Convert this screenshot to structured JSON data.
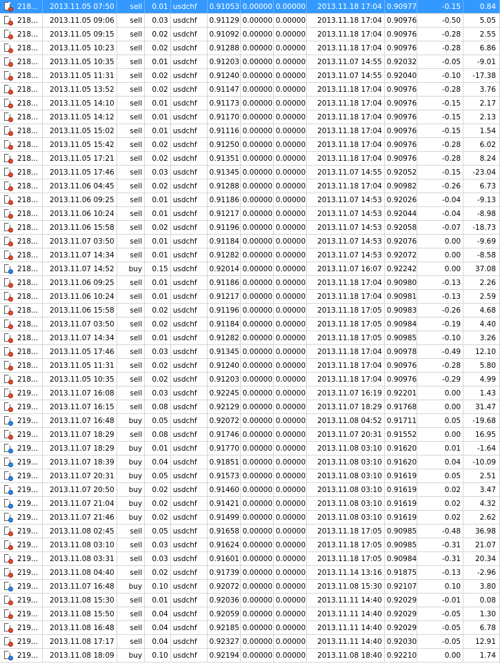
{
  "rows": [
    {
      "ticket": "218...",
      "open_time": "2013.11.05 07:50",
      "type": "sell",
      "size": "0.01",
      "symbol": "usdchf",
      "price": "0.91053",
      "sl": "0.00000",
      "tp": "0.00000",
      "close_time": "2013.11.18 17:04",
      "close_price": "0.90977",
      "commission": "-0.15",
      "profit": "0.84",
      "icon": "sell-order-icon",
      "selected": true
    },
    {
      "ticket": "218...",
      "open_time": "2013.11.05 09:06",
      "type": "sell",
      "size": "0.03",
      "symbol": "usdchf",
      "price": "0.91129",
      "sl": "0.00000",
      "tp": "0.00000",
      "close_time": "2013.11.18 17:04",
      "close_price": "0.90976",
      "commission": "-0.50",
      "profit": "5.05",
      "icon": "sell-order-icon"
    },
    {
      "ticket": "218...",
      "open_time": "2013.11.05 09:15",
      "type": "sell",
      "size": "0.02",
      "symbol": "usdchf",
      "price": "0.91092",
      "sl": "0.00000",
      "tp": "0.00000",
      "close_time": "2013.11.18 17:04",
      "close_price": "0.90976",
      "commission": "-0.28",
      "profit": "2.55",
      "icon": "sell-order-icon"
    },
    {
      "ticket": "218...",
      "open_time": "2013.11.05 10:23",
      "type": "sell",
      "size": "0.02",
      "symbol": "usdchf",
      "price": "0.91288",
      "sl": "0.00000",
      "tp": "0.00000",
      "close_time": "2013.11.18 17:04",
      "close_price": "0.90976",
      "commission": "-0.28",
      "profit": "6.86",
      "icon": "sell-order-icon"
    },
    {
      "ticket": "218...",
      "open_time": "2013.11.05 10:35",
      "type": "sell",
      "size": "0.01",
      "symbol": "usdchf",
      "price": "0.91203",
      "sl": "0.00000",
      "tp": "0.00000",
      "close_time": "2013.11.07 14:55",
      "close_price": "0.92032",
      "commission": "-0.05",
      "profit": "-9.01",
      "icon": "sell-order-icon"
    },
    {
      "ticket": "218...",
      "open_time": "2013.11.05 11:31",
      "type": "sell",
      "size": "0.02",
      "symbol": "usdchf",
      "price": "0.91240",
      "sl": "0.00000",
      "tp": "0.00000",
      "close_time": "2013.11.07 14:55",
      "close_price": "0.92040",
      "commission": "-0.10",
      "profit": "-17.38",
      "icon": "sell-order-icon"
    },
    {
      "ticket": "218...",
      "open_time": "2013.11.05 13:52",
      "type": "sell",
      "size": "0.02",
      "symbol": "usdchf",
      "price": "0.91147",
      "sl": "0.00000",
      "tp": "0.00000",
      "close_time": "2013.11.18 17:04",
      "close_price": "0.90976",
      "commission": "-0.28",
      "profit": "3.76",
      "icon": "sell-order-icon"
    },
    {
      "ticket": "218...",
      "open_time": "2013.11.05 14:10",
      "type": "sell",
      "size": "0.01",
      "symbol": "usdchf",
      "price": "0.91173",
      "sl": "0.00000",
      "tp": "0.00000",
      "close_time": "2013.11.18 17:04",
      "close_price": "0.90976",
      "commission": "-0.15",
      "profit": "2.17",
      "icon": "sell-order-icon"
    },
    {
      "ticket": "218...",
      "open_time": "2013.11.05 14:12",
      "type": "sell",
      "size": "0.01",
      "symbol": "usdchf",
      "price": "0.91170",
      "sl": "0.00000",
      "tp": "0.00000",
      "close_time": "2013.11.18 17:04",
      "close_price": "0.90976",
      "commission": "-0.15",
      "profit": "2.13",
      "icon": "sell-order-icon"
    },
    {
      "ticket": "218...",
      "open_time": "2013.11.05 15:02",
      "type": "sell",
      "size": "0.01",
      "symbol": "usdchf",
      "price": "0.91116",
      "sl": "0.00000",
      "tp": "0.00000",
      "close_time": "2013.11.18 17:04",
      "close_price": "0.90976",
      "commission": "-0.15",
      "profit": "1.54",
      "icon": "sell-order-icon"
    },
    {
      "ticket": "218...",
      "open_time": "2013.11.05 15:42",
      "type": "sell",
      "size": "0.02",
      "symbol": "usdchf",
      "price": "0.91250",
      "sl": "0.00000",
      "tp": "0.00000",
      "close_time": "2013.11.18 17:04",
      "close_price": "0.90976",
      "commission": "-0.28",
      "profit": "6.02",
      "icon": "sell-order-icon"
    },
    {
      "ticket": "218...",
      "open_time": "2013.11.05 17:21",
      "type": "sell",
      "size": "0.02",
      "symbol": "usdchf",
      "price": "0.91351",
      "sl": "0.00000",
      "tp": "0.00000",
      "close_time": "2013.11.18 17:04",
      "close_price": "0.90976",
      "commission": "-0.28",
      "profit": "8.24",
      "icon": "sell-order-icon"
    },
    {
      "ticket": "218...",
      "open_time": "2013.11.05 17:46",
      "type": "sell",
      "size": "0.03",
      "symbol": "usdchf",
      "price": "0.91345",
      "sl": "0.00000",
      "tp": "0.00000",
      "close_time": "2013.11.07 14:55",
      "close_price": "0.92052",
      "commission": "-0.15",
      "profit": "-23.04",
      "icon": "sell-order-icon"
    },
    {
      "ticket": "218...",
      "open_time": "2013.11.06 04:45",
      "type": "sell",
      "size": "0.02",
      "symbol": "usdchf",
      "price": "0.91288",
      "sl": "0.00000",
      "tp": "0.00000",
      "close_time": "2013.11.18 17:04",
      "close_price": "0.90982",
      "commission": "-0.26",
      "profit": "6.73",
      "icon": "sell-order-icon"
    },
    {
      "ticket": "218...",
      "open_time": "2013.11.06 09:25",
      "type": "sell",
      "size": "0.01",
      "symbol": "usdchf",
      "price": "0.91186",
      "sl": "0.00000",
      "tp": "0.00000",
      "close_time": "2013.11.07 14:53",
      "close_price": "0.92026",
      "commission": "-0.04",
      "profit": "-9.13",
      "icon": "sell-order-icon"
    },
    {
      "ticket": "218...",
      "open_time": "2013.11.06 10:24",
      "type": "sell",
      "size": "0.01",
      "symbol": "usdchf",
      "price": "0.91217",
      "sl": "0.00000",
      "tp": "0.00000",
      "close_time": "2013.11.07 14:53",
      "close_price": "0.92044",
      "commission": "-0.04",
      "profit": "-8.98",
      "icon": "sell-order-icon"
    },
    {
      "ticket": "218...",
      "open_time": "2013.11.06 15:58",
      "type": "sell",
      "size": "0.02",
      "symbol": "usdchf",
      "price": "0.91196",
      "sl": "0.00000",
      "tp": "0.00000",
      "close_time": "2013.11.07 14:53",
      "close_price": "0.92058",
      "commission": "-0.07",
      "profit": "-18.73",
      "icon": "sell-order-icon"
    },
    {
      "ticket": "218...",
      "open_time": "2013.11.07 03:50",
      "type": "sell",
      "size": "0.01",
      "symbol": "usdchf",
      "price": "0.91184",
      "sl": "0.00000",
      "tp": "0.00000",
      "close_time": "2013.11.07 14:53",
      "close_price": "0.92076",
      "commission": "0.00",
      "profit": "-9.69",
      "icon": "sell-order-icon"
    },
    {
      "ticket": "218...",
      "open_time": "2013.11.07 14:34",
      "type": "sell",
      "size": "0.01",
      "symbol": "usdchf",
      "price": "0.91282",
      "sl": "0.00000",
      "tp": "0.00000",
      "close_time": "2013.11.07 14:53",
      "close_price": "0.92072",
      "commission": "0.00",
      "profit": "-8.58",
      "icon": "sell-order-icon"
    },
    {
      "ticket": "218...",
      "open_time": "2013.11.07 14:52",
      "type": "buy",
      "size": "0.15",
      "symbol": "usdchf",
      "price": "0.92014",
      "sl": "0.00000",
      "tp": "0.00000",
      "close_time": "2013.11.07 16:07",
      "close_price": "0.92242",
      "commission": "0.00",
      "profit": "37.08",
      "icon": "buy-order-icon"
    },
    {
      "ticket": "218...",
      "open_time": "2013.11.06 09:25",
      "type": "sell",
      "size": "0.01",
      "symbol": "usdchf",
      "price": "0.91186",
      "sl": "0.00000",
      "tp": "0.00000",
      "close_time": "2013.11.18 17:04",
      "close_price": "0.90980",
      "commission": "-0.13",
      "profit": "2.26",
      "icon": "sell-order-icon"
    },
    {
      "ticket": "218...",
      "open_time": "2013.11.06 10:24",
      "type": "sell",
      "size": "0.01",
      "symbol": "usdchf",
      "price": "0.91217",
      "sl": "0.00000",
      "tp": "0.00000",
      "close_time": "2013.11.18 17:04",
      "close_price": "0.90981",
      "commission": "-0.13",
      "profit": "2.59",
      "icon": "sell-order-icon"
    },
    {
      "ticket": "218...",
      "open_time": "2013.11.06 15:58",
      "type": "sell",
      "size": "0.02",
      "symbol": "usdchf",
      "price": "0.91196",
      "sl": "0.00000",
      "tp": "0.00000",
      "close_time": "2013.11.18 17:05",
      "close_price": "0.90983",
      "commission": "-0.26",
      "profit": "4.68",
      "icon": "sell-order-icon"
    },
    {
      "ticket": "218...",
      "open_time": "2013.11.07 03:50",
      "type": "sell",
      "size": "0.02",
      "symbol": "usdchf",
      "price": "0.91184",
      "sl": "0.00000",
      "tp": "0.00000",
      "close_time": "2013.11.18 17:05",
      "close_price": "0.90984",
      "commission": "-0.19",
      "profit": "4.40",
      "icon": "sell-order-icon"
    },
    {
      "ticket": "218...",
      "open_time": "2013.11.07 14:34",
      "type": "sell",
      "size": "0.01",
      "symbol": "usdchf",
      "price": "0.91282",
      "sl": "0.00000",
      "tp": "0.00000",
      "close_time": "2013.11.18 17:05",
      "close_price": "0.90985",
      "commission": "-0.10",
      "profit": "3.26",
      "icon": "sell-order-icon"
    },
    {
      "ticket": "218...",
      "open_time": "2013.11.05 17:46",
      "type": "sell",
      "size": "0.03",
      "symbol": "usdchf",
      "price": "0.91345",
      "sl": "0.00000",
      "tp": "0.00000",
      "close_time": "2013.11.18 17:04",
      "close_price": "0.90978",
      "commission": "-0.49",
      "profit": "12.10",
      "icon": "sell-order-icon"
    },
    {
      "ticket": "218...",
      "open_time": "2013.11.05 11:31",
      "type": "sell",
      "size": "0.02",
      "symbol": "usdchf",
      "price": "0.91240",
      "sl": "0.00000",
      "tp": "0.00000",
      "close_time": "2013.11.18 17:04",
      "close_price": "0.90976",
      "commission": "-0.28",
      "profit": "5.80",
      "icon": "sell-order-icon"
    },
    {
      "ticket": "218...",
      "open_time": "2013.11.05 10:35",
      "type": "sell",
      "size": "0.02",
      "symbol": "usdchf",
      "price": "0.91203",
      "sl": "0.00000",
      "tp": "0.00000",
      "close_time": "2013.11.18 17:04",
      "close_price": "0.90976",
      "commission": "-0.29",
      "profit": "4.99",
      "icon": "sell-order-icon"
    },
    {
      "ticket": "219...",
      "open_time": "2013.11.07 16:08",
      "type": "sell",
      "size": "0.03",
      "symbol": "usdchf",
      "price": "0.92245",
      "sl": "0.00000",
      "tp": "0.00000",
      "close_time": "2013.11.07 16:19",
      "close_price": "0.92201",
      "commission": "0.00",
      "profit": "1.43",
      "icon": "sell-order-icon"
    },
    {
      "ticket": "219...",
      "open_time": "2013.11.07 16:15",
      "type": "sell",
      "size": "0.08",
      "symbol": "usdchf",
      "price": "0.92129",
      "sl": "0.00000",
      "tp": "0.00000",
      "close_time": "2013.11.07 18:29",
      "close_price": "0.91768",
      "commission": "0.00",
      "profit": "31.47",
      "icon": "sell-order-icon"
    },
    {
      "ticket": "219...",
      "open_time": "2013.11.07 16:48",
      "type": "buy",
      "size": "0.05",
      "symbol": "usdchf",
      "price": "0.92072",
      "sl": "0.00000",
      "tp": "0.00000",
      "close_time": "2013.11.08 04:52",
      "close_price": "0.91711",
      "commission": "0.05",
      "profit": "-19.68",
      "icon": "buy-order-icon"
    },
    {
      "ticket": "219...",
      "open_time": "2013.11.07 18:29",
      "type": "sell",
      "size": "0.08",
      "symbol": "usdchf",
      "price": "0.91746",
      "sl": "0.00000",
      "tp": "0.00000",
      "close_time": "2013.11.07 20:31",
      "close_price": "0.91552",
      "commission": "0.00",
      "profit": "16.95",
      "icon": "sell-order-icon"
    },
    {
      "ticket": "219...",
      "open_time": "2013.11.07 18:29",
      "type": "buy",
      "size": "0.01",
      "symbol": "usdchf",
      "price": "0.91770",
      "sl": "0.00000",
      "tp": "0.00000",
      "close_time": "2013.11.08 03:10",
      "close_price": "0.91620",
      "commission": "0.01",
      "profit": "-1.64",
      "icon": "buy-order-icon"
    },
    {
      "ticket": "219...",
      "open_time": "2013.11.07 18:39",
      "type": "buy",
      "size": "0.04",
      "symbol": "usdchf",
      "price": "0.91851",
      "sl": "0.00000",
      "tp": "0.00000",
      "close_time": "2013.11.08 03:10",
      "close_price": "0.91620",
      "commission": "0.04",
      "profit": "-10.09",
      "icon": "buy-order-icon"
    },
    {
      "ticket": "219...",
      "open_time": "2013.11.07 20:31",
      "type": "buy",
      "size": "0.05",
      "symbol": "usdchf",
      "price": "0.91573",
      "sl": "0.00000",
      "tp": "0.00000",
      "close_time": "2013.11.08 03:10",
      "close_price": "0.91619",
      "commission": "0.05",
      "profit": "2.51",
      "icon": "buy-order-icon"
    },
    {
      "ticket": "219...",
      "open_time": "2013.11.07 20:50",
      "type": "buy",
      "size": "0.02",
      "symbol": "usdchf",
      "price": "0.91460",
      "sl": "0.00000",
      "tp": "0.00000",
      "close_time": "2013.11.08 03:10",
      "close_price": "0.91619",
      "commission": "0.02",
      "profit": "3.47",
      "icon": "buy-order-icon"
    },
    {
      "ticket": "219...",
      "open_time": "2013.11.07 21:04",
      "type": "buy",
      "size": "0.02",
      "symbol": "usdchf",
      "price": "0.91421",
      "sl": "0.00000",
      "tp": "0.00000",
      "close_time": "2013.11.08 03:10",
      "close_price": "0.91619",
      "commission": "0.02",
      "profit": "4.32",
      "icon": "buy-order-icon"
    },
    {
      "ticket": "219...",
      "open_time": "2013.11.07 21:46",
      "type": "buy",
      "size": "0.02",
      "symbol": "usdchf",
      "price": "0.91499",
      "sl": "0.00000",
      "tp": "0.00000",
      "close_time": "2013.11.08 03:10",
      "close_price": "0.91619",
      "commission": "0.02",
      "profit": "2.62",
      "icon": "buy-order-icon"
    },
    {
      "ticket": "219...",
      "open_time": "2013.11.08 02:45",
      "type": "sell",
      "size": "0.05",
      "symbol": "usdchf",
      "price": "0.91658",
      "sl": "0.00000",
      "tp": "0.00000",
      "close_time": "2013.11.18 17:05",
      "close_price": "0.90985",
      "commission": "-0.48",
      "profit": "36.98",
      "icon": "sell-order-icon"
    },
    {
      "ticket": "219...",
      "open_time": "2013.11.08 03:10",
      "type": "sell",
      "size": "0.03",
      "symbol": "usdchf",
      "price": "0.91624",
      "sl": "0.00000",
      "tp": "0.00000",
      "close_time": "2013.11.18 17:05",
      "close_price": "0.90985",
      "commission": "-0.31",
      "profit": "21.07",
      "icon": "sell-order-icon"
    },
    {
      "ticket": "219...",
      "open_time": "2013.11.08 03:31",
      "type": "sell",
      "size": "0.03",
      "symbol": "usdchf",
      "price": "0.91601",
      "sl": "0.00000",
      "tp": "0.00000",
      "close_time": "2013.11.18 17:05",
      "close_price": "0.90984",
      "commission": "-0.31",
      "profit": "20.34",
      "icon": "sell-order-icon"
    },
    {
      "ticket": "219...",
      "open_time": "2013.11.08 04:40",
      "type": "sell",
      "size": "0.02",
      "symbol": "usdchf",
      "price": "0.91739",
      "sl": "0.00000",
      "tp": "0.00000",
      "close_time": "2013.11.14 13:16",
      "close_price": "0.91875",
      "commission": "-0.13",
      "profit": "-2.96",
      "icon": "sell-order-icon"
    },
    {
      "ticket": "219...",
      "open_time": "2013.11.07 16:48",
      "type": "buy",
      "size": "0.10",
      "symbol": "usdchf",
      "price": "0.92072",
      "sl": "0.00000",
      "tp": "0.00000",
      "close_time": "2013.11.08 15:30",
      "close_price": "0.92107",
      "commission": "0.10",
      "profit": "3.80",
      "icon": "buy-order-icon"
    },
    {
      "ticket": "219...",
      "open_time": "2013.11.08 15:30",
      "type": "sell",
      "size": "0.01",
      "symbol": "usdchf",
      "price": "0.92036",
      "sl": "0.00000",
      "tp": "0.00000",
      "close_time": "2013.11.11 14:40",
      "close_price": "0.92029",
      "commission": "-0.01",
      "profit": "0.08",
      "icon": "sell-order-icon"
    },
    {
      "ticket": "219...",
      "open_time": "2013.11.08 15:50",
      "type": "sell",
      "size": "0.04",
      "symbol": "usdchf",
      "price": "0.92059",
      "sl": "0.00000",
      "tp": "0.00000",
      "close_time": "2013.11.11 14:40",
      "close_price": "0.92029",
      "commission": "-0.05",
      "profit": "1.30",
      "icon": "sell-order-icon"
    },
    {
      "ticket": "219...",
      "open_time": "2013.11.08 16:48",
      "type": "sell",
      "size": "0.04",
      "symbol": "usdchf",
      "price": "0.92185",
      "sl": "0.00000",
      "tp": "0.00000",
      "close_time": "2013.11.11 14:40",
      "close_price": "0.92029",
      "commission": "-0.05",
      "profit": "6.78",
      "icon": "sell-order-icon"
    },
    {
      "ticket": "219...",
      "open_time": "2013.11.08 17:17",
      "type": "sell",
      "size": "0.04",
      "symbol": "usdchf",
      "price": "0.92327",
      "sl": "0.00000",
      "tp": "0.00000",
      "close_time": "2013.11.11 14:40",
      "close_price": "0.92030",
      "commission": "-0.05",
      "profit": "12.91",
      "icon": "sell-order-icon"
    },
    {
      "ticket": "219...",
      "open_time": "2013.11.08 18:09",
      "type": "buy",
      "size": "0.10",
      "symbol": "usdchf",
      "price": "0.92194",
      "sl": "0.00000",
      "tp": "0.00000",
      "close_time": "2013.11.08 18:40",
      "close_price": "0.92210",
      "commission": "0.00",
      "profit": "1.74",
      "icon": "buy-order-icon"
    }
  ],
  "colors": {
    "selected_bg": "#3399ff",
    "grid_line": "#d5d5d5",
    "sell_dot": "#e84a2a",
    "buy_dot": "#2a8ae8"
  }
}
